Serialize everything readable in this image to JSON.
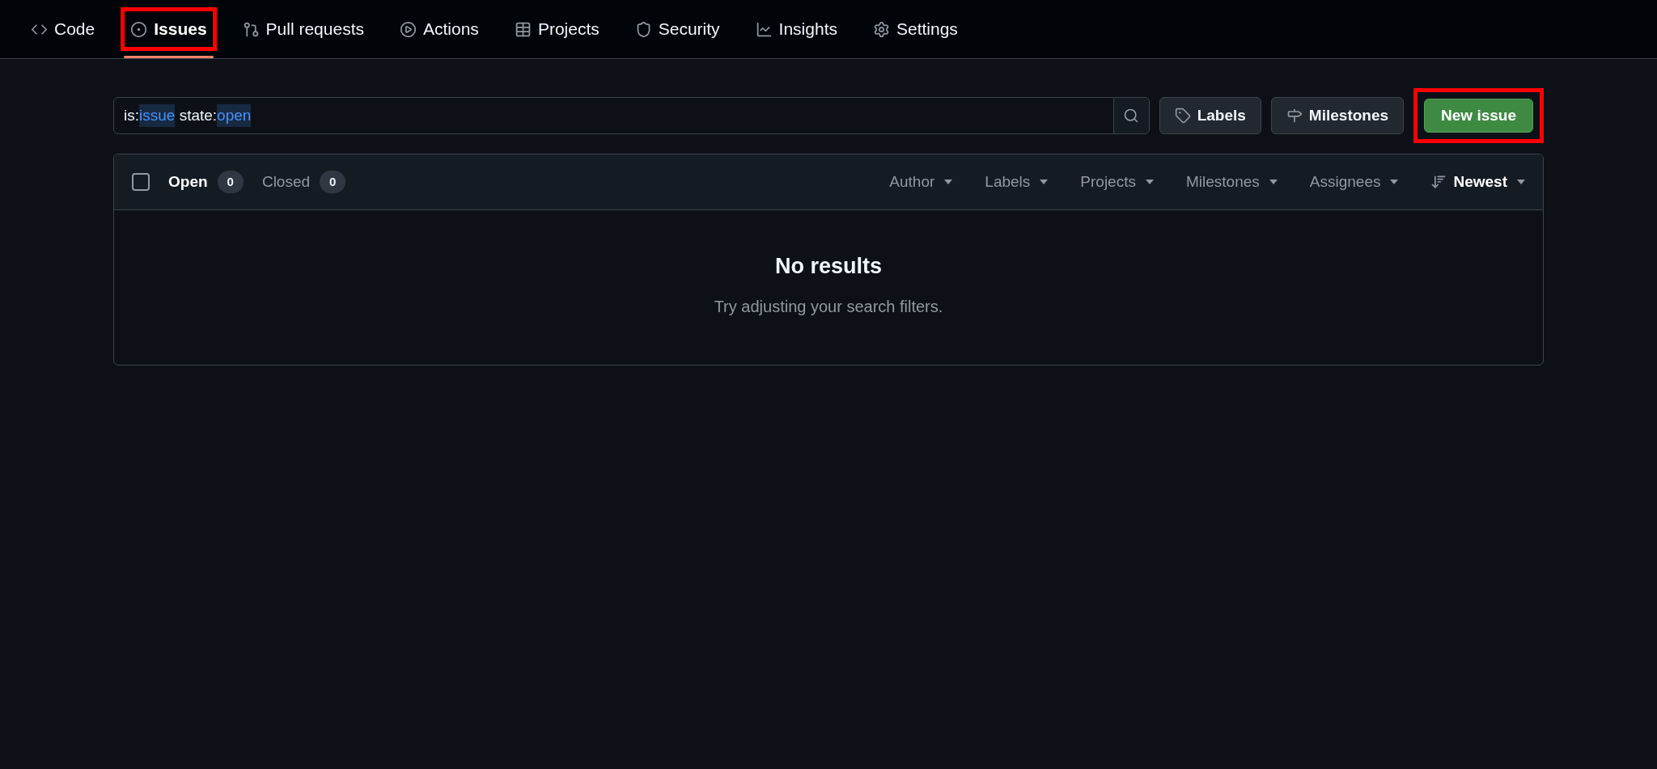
{
  "nav": {
    "tabs": [
      {
        "label": "Code",
        "selected": false,
        "highlighted": false
      },
      {
        "label": "Issues",
        "selected": true,
        "highlighted": true
      },
      {
        "label": "Pull requests",
        "selected": false,
        "highlighted": false
      },
      {
        "label": "Actions",
        "selected": false,
        "highlighted": false
      },
      {
        "label": "Projects",
        "selected": false,
        "highlighted": false
      },
      {
        "label": "Security",
        "selected": false,
        "highlighted": false
      },
      {
        "label": "Insights",
        "selected": false,
        "highlighted": false
      },
      {
        "label": "Settings",
        "selected": false,
        "highlighted": false
      }
    ]
  },
  "search": {
    "tokens": [
      {
        "text": "is:",
        "kind": "key"
      },
      {
        "text": "issue",
        "kind": "value"
      },
      {
        "text": " state:",
        "kind": "key"
      },
      {
        "text": "open",
        "kind": "value"
      }
    ]
  },
  "toolbar_buttons": [
    {
      "label": "Labels"
    },
    {
      "label": "Milestones"
    }
  ],
  "new_issue": {
    "label": "New issue",
    "highlighted": true
  },
  "list_header": {
    "checked": false,
    "states": [
      {
        "label": "Open",
        "count": "0",
        "selected": true
      },
      {
        "label": "Closed",
        "count": "0",
        "selected": false
      }
    ],
    "filters": [
      {
        "label": "Author",
        "kind": "filter"
      },
      {
        "label": "Labels",
        "kind": "filter"
      },
      {
        "label": "Projects",
        "kind": "filter"
      },
      {
        "label": "Milestones",
        "kind": "filter"
      },
      {
        "label": "Assignees",
        "kind": "filter"
      },
      {
        "label": "Newest",
        "kind": "sort"
      }
    ]
  },
  "empty_state": {
    "title": "No results",
    "message": "Try adjusting your search filters."
  }
}
